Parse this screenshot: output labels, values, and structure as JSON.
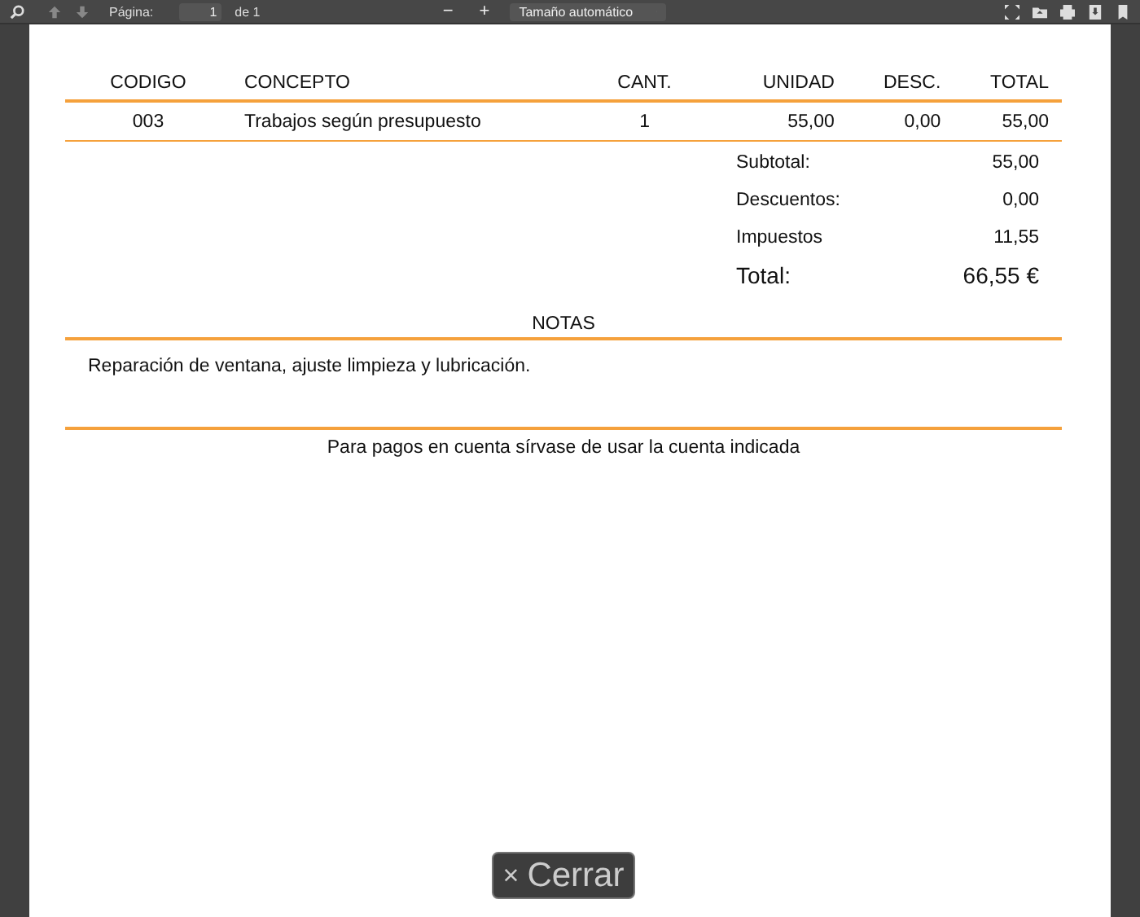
{
  "toolbar": {
    "page_label": "Página:",
    "page_value": "1",
    "page_total": "de 1",
    "zoom_out": "−",
    "zoom_in": "+",
    "zoom_select": "Tamaño automático"
  },
  "table": {
    "columns": [
      "CODIGO",
      "CONCEPTO",
      "CANT.",
      "UNIDAD",
      "DESC.",
      "TOTAL"
    ],
    "rows": [
      [
        "003",
        "Trabajos según presupuesto",
        "1",
        "55,00",
        "0,00",
        "55,00"
      ]
    ]
  },
  "totals": [
    {
      "label": "Subtotal:",
      "value": "55,00",
      "kind": "normal"
    },
    {
      "label": "Descuentos:",
      "value": "0,00",
      "kind": "normal"
    },
    {
      "label": "Impuestos",
      "value": "11,55",
      "kind": "normal"
    },
    {
      "label": "Total:",
      "value": "66,55 €",
      "kind": "grand"
    }
  ],
  "notes": {
    "title": "NOTAS",
    "text": "Reparación de ventana, ajuste limpieza y lubricación."
  },
  "footer": "Para pagos en cuenta sírvase de usar la cuenta indicada",
  "close_button": {
    "icon": "×",
    "label": "Cerrar"
  }
}
